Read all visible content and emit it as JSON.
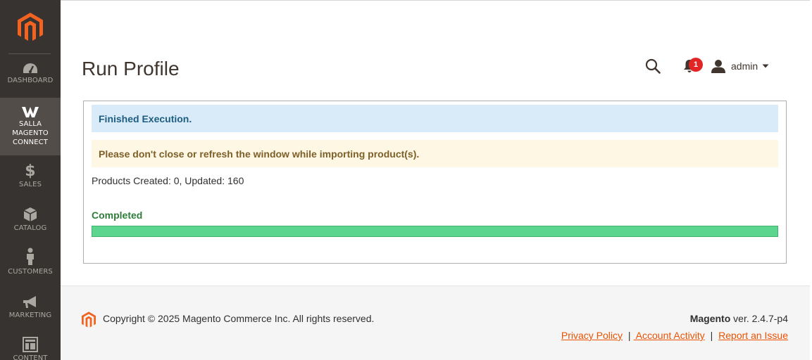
{
  "sidebar": {
    "items": [
      {
        "label": "Dashboard",
        "icon": "dashboard-icon"
      },
      {
        "label": "Salla Magento Connect",
        "icon": "salla-icon",
        "active": true
      },
      {
        "label": "Sales",
        "icon": "dollar-icon"
      },
      {
        "label": "Catalog",
        "icon": "box-icon"
      },
      {
        "label": "Customers",
        "icon": "person-icon"
      },
      {
        "label": "Marketing",
        "icon": "megaphone-icon"
      },
      {
        "label": "Content",
        "icon": "layout-icon"
      }
    ]
  },
  "header": {
    "title": "Run Profile",
    "notifications_count": "1",
    "user": "admin"
  },
  "panel": {
    "info_message": "Finished Execution.",
    "warning_message": "Please don't close or refresh the window while importing product(s).",
    "counts": "Products Created: 0, Updated: 160",
    "status": "Completed",
    "progress_percent": 100
  },
  "footer": {
    "copyright": "Copyright © 2025 Magento Commerce Inc. All rights reserved.",
    "brand": "Magento",
    "version": " ver. 2.4.7-p4",
    "links": {
      "privacy": "Privacy Policy",
      "sep1": "|",
      "activity": " Account Activity",
      "sep2": "|",
      "report": "Report an Issue"
    }
  },
  "colors": {
    "sidebar_bg": "#373330",
    "accent": "#eb5202",
    "progress": "#5cd58f",
    "info_bg": "#d9ebf8",
    "warning_bg": "#fdf7e4"
  }
}
